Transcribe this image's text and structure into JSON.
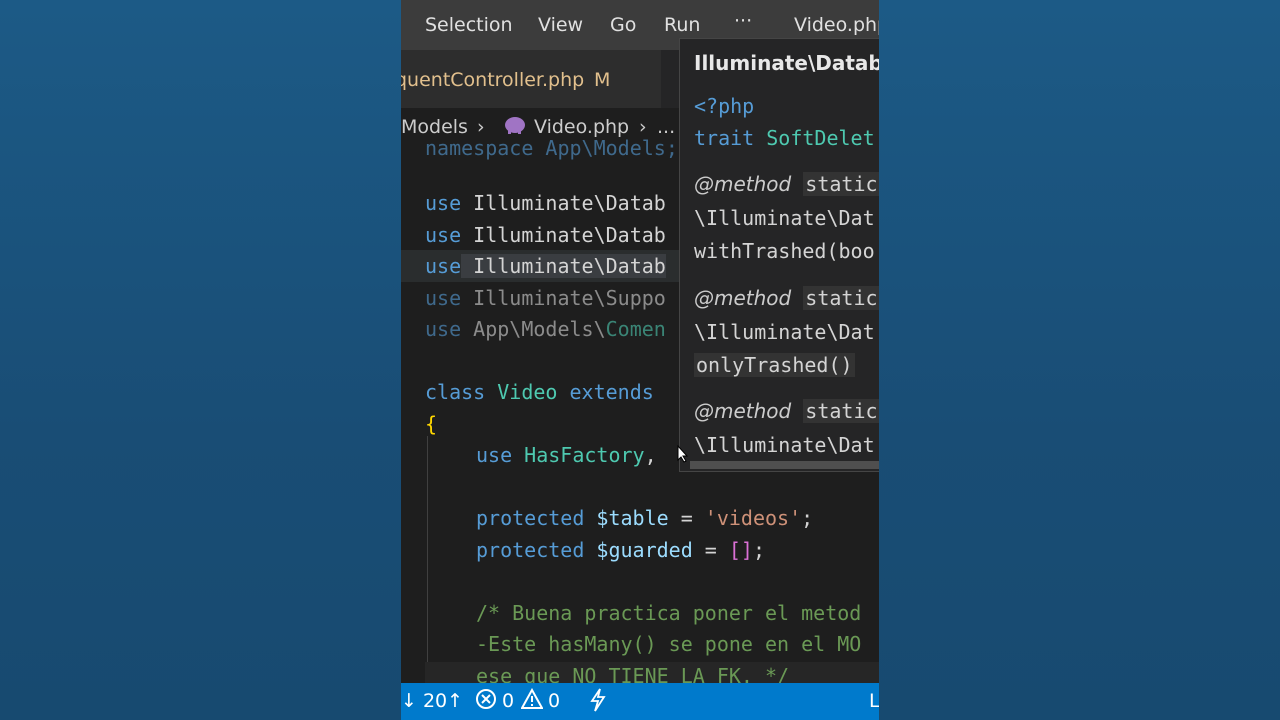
{
  "menu": {
    "selection": "Selection",
    "view": "View",
    "go": "Go",
    "run": "Run",
    "more": "···",
    "window_title": "Video.php"
  },
  "tab": {
    "label": "quentController.php",
    "modified": "M"
  },
  "breadcrumb": {
    "models": "Models",
    "sep": "›",
    "file": "Video.php",
    "more": "..."
  },
  "code": {
    "l0": "namespace App\\Models;",
    "l2a": "use",
    "l2b": " Illuminate\\Datab",
    "l3a": "use",
    "l3b": " Illuminate\\Datab",
    "l4a": "use",
    "l4b": " Illuminate\\Datab",
    "l5a": "use",
    "l5b": " Illuminate\\Suppo",
    "l6a": "use",
    "l6b": " App\\Models\\",
    "l6c": "Comen",
    "l8a": "class",
    "l8b": " Video",
    "l8c": " extends",
    "l9": "{",
    "l10a": "use",
    "l10b": " HasFactory",
    "l10c": ",",
    "l12a": "protected",
    "l12b": " $table",
    "l12c": " = ",
    "l12d": "'videos'",
    "l12e": ";",
    "l13a": "protected",
    "l13b": " $guarded",
    "l13c": " = ",
    "l13d": "[]",
    "l13e": ";",
    "l15": "/* Buena practica poner el metod",
    "l16": "-Este hasMany() se pone en el MO",
    "l17": "ese que NO TIENE LA FK. */"
  },
  "hover": {
    "title": "Illuminate\\Datab",
    "php_tag": "<?php",
    "trait_kw": "trait",
    "trait_name": " SoftDelet",
    "method1_at": "@method",
    "method1_static": "static",
    "method1_ns": "\\Illuminate\\Dat",
    "method1_name": "withTrashed(boo",
    "method2_at": "@method",
    "method2_static": "static",
    "method2_ns": "\\Illuminate\\Dat",
    "method2_name": "onlyTrashed()",
    "method3_at": "@method",
    "method3_static": "static",
    "method3_ns": "\\Illuminate\\Dat"
  },
  "status": {
    "sync": "↓ 20↑",
    "errors": "0",
    "warnings": "0",
    "right": "L"
  }
}
